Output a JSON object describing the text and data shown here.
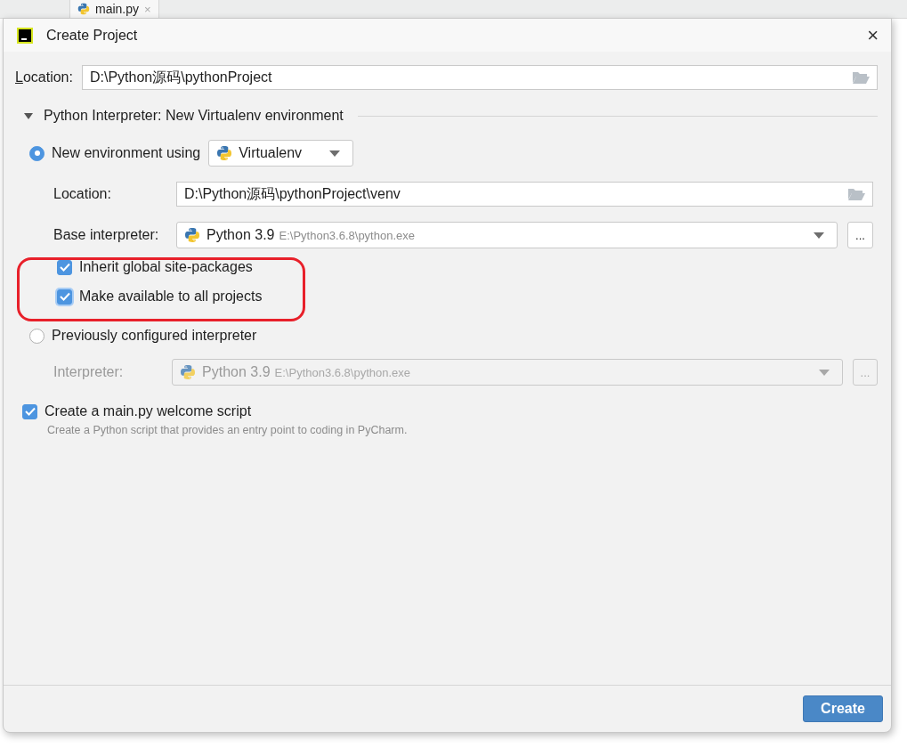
{
  "background_tab": {
    "label": "main.py",
    "close": "×"
  },
  "window": {
    "title": "Create Project",
    "close": "×"
  },
  "location": {
    "label": "Location:",
    "value": "D:\\Python源码\\pythonProject"
  },
  "interpreter_section": {
    "title": "Python Interpreter: New Virtualenv environment",
    "expanded": true
  },
  "env_options": [
    {
      "kind": "new",
      "label": "New environment using",
      "selected": true,
      "tool": "Virtualenv",
      "location_label": "Location:",
      "location": "D:\\Python源码\\pythonProject\\venv",
      "base_label": "Base interpreter:",
      "base_name": "Python 3.9",
      "base_path": "E:\\Python3.6.8\\python.exe",
      "browse": "...",
      "checkboxes": [
        {
          "label": "Inherit global site-packages",
          "checked": true,
          "focused": false
        },
        {
          "label": "Make available to all projects",
          "checked": true,
          "focused": true
        }
      ]
    },
    {
      "kind": "existing",
      "label": "Previously configured interpreter",
      "selected": false,
      "interpreter_label": "Interpreter:",
      "interpreter_name": "Python 3.9",
      "interpreter_path": "E:\\Python3.6.8\\python.exe",
      "browse": "...",
      "disabled": true
    }
  ],
  "welcome_script": {
    "label": "Create a main.py welcome script",
    "checked": true,
    "hint": "Create a Python script that provides an entry point to coding in PyCharm."
  },
  "buttons": [
    {
      "label": "Create",
      "kind": "primary"
    }
  ]
}
